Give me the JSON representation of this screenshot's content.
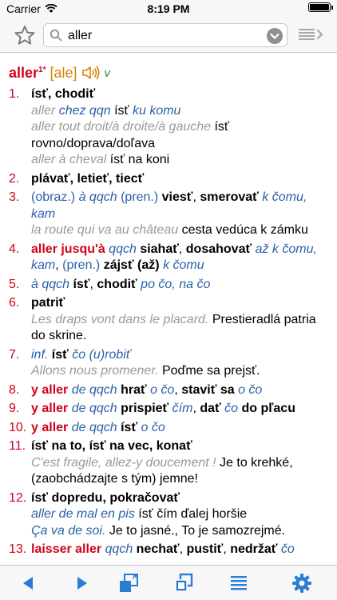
{
  "status_bar": {
    "carrier": "Carrier",
    "time": "8:19 PM",
    "battery_level_percent": 100
  },
  "search": {
    "value": "aller",
    "placeholder": ""
  },
  "colors": {
    "accent": "#2b7cd3",
    "headword": "#d0021b",
    "pronunciation": "#d9800a",
    "pos": "#2e8b2e",
    "example": "#999999",
    "label": "#2b5fa8"
  },
  "entry": {
    "headword": "aller",
    "homonym": "1*",
    "pronunciation": "[ale]",
    "pos": "v"
  },
  "senses": [
    {
      "num": "1.",
      "parts": [
        [
          "skb",
          "ísť, chodiť"
        ],
        [
          "br",
          ""
        ],
        [
          "fr",
          "aller "
        ],
        [
          "lbli",
          "chez qqn "
        ],
        [
          "sk",
          "ísť "
        ],
        [
          "lbli",
          "ku komu"
        ],
        [
          "br",
          ""
        ],
        [
          "fr",
          "aller tout droit/à droite/à gauche "
        ],
        [
          "sk",
          "ísť rovno/doprava/doľava"
        ],
        [
          "br",
          ""
        ],
        [
          "fr",
          "aller à cheval "
        ],
        [
          "sk",
          "ísť na koni"
        ]
      ]
    },
    {
      "num": "2.",
      "parts": [
        [
          "skb",
          "plávať, letieť, tiecť"
        ]
      ]
    },
    {
      "num": "3.",
      "parts": [
        [
          "lbl",
          "(obraz.) "
        ],
        [
          "lbli",
          "à qqch "
        ],
        [
          "lbl",
          "(pren.) "
        ],
        [
          "skb",
          "viesť"
        ],
        [
          "sk",
          ", "
        ],
        [
          "skb",
          "smerovať "
        ],
        [
          "lbli",
          "k čomu, kam"
        ],
        [
          "br",
          ""
        ],
        [
          "fr",
          "la route qui va au château "
        ],
        [
          "sk",
          "cesta vedúca k zámku"
        ]
      ]
    },
    {
      "num": "4.",
      "parts": [
        [
          "frb",
          "aller jusqu'à "
        ],
        [
          "lbli",
          "qqch "
        ],
        [
          "skb",
          "siahať"
        ],
        [
          "sk",
          ", "
        ],
        [
          "skb",
          "dosahovať "
        ],
        [
          "lbli",
          "až k čomu, kam"
        ],
        [
          "sk",
          ", "
        ],
        [
          "lbl",
          "(pren.) "
        ],
        [
          "skb",
          "zájsť (až) "
        ],
        [
          "lbli",
          "k čomu"
        ]
      ]
    },
    {
      "num": "5.",
      "parts": [
        [
          "lbli",
          "à qqch "
        ],
        [
          "skb",
          "ísť"
        ],
        [
          "sk",
          ", "
        ],
        [
          "skb",
          "chodiť "
        ],
        [
          "lbli",
          "po čo, na čo"
        ]
      ]
    },
    {
      "num": "6.",
      "parts": [
        [
          "skb",
          "patriť"
        ],
        [
          "br",
          ""
        ],
        [
          "fr",
          "Les draps vont dans le placard. "
        ],
        [
          "sk",
          "Prestieradlá patria do skrine."
        ]
      ]
    },
    {
      "num": "7.",
      "parts": [
        [
          "lbli",
          "inf. "
        ],
        [
          "skb",
          "ísť "
        ],
        [
          "lbli",
          "čo (u)robiť"
        ],
        [
          "br",
          ""
        ],
        [
          "fr",
          "Allons nous promener. "
        ],
        [
          "sk",
          "Poďme sa prejsť."
        ]
      ]
    },
    {
      "num": "8.",
      "parts": [
        [
          "frb",
          "y aller "
        ],
        [
          "lbli",
          "de qqch "
        ],
        [
          "skb",
          "hrať "
        ],
        [
          "lbli",
          "o čo"
        ],
        [
          "sk",
          ", "
        ],
        [
          "skb",
          "staviť sa "
        ],
        [
          "lbli",
          "o čo"
        ]
      ]
    },
    {
      "num": "9.",
      "parts": [
        [
          "frb",
          "y aller "
        ],
        [
          "lbli",
          "de qqch "
        ],
        [
          "skb",
          "prispieť "
        ],
        [
          "lbli",
          "čím"
        ],
        [
          "sk",
          ", "
        ],
        [
          "skb",
          "dať "
        ],
        [
          "lbli",
          "čo "
        ],
        [
          "skb",
          "do pľacu"
        ]
      ]
    },
    {
      "num": "10.",
      "parts": [
        [
          "frb",
          "y aller "
        ],
        [
          "lbli",
          "de qqch "
        ],
        [
          "skb",
          "ísť "
        ],
        [
          "lbli",
          "o čo"
        ]
      ]
    },
    {
      "num": "11.",
      "parts": [
        [
          "skb",
          "ísť na to, ísť na vec, konať"
        ],
        [
          "br",
          ""
        ],
        [
          "fr",
          "C'est fragile, allez-y doucement ! "
        ],
        [
          "sk",
          "Je to krehké, (zaobchádzajte s tým) jemne!"
        ]
      ]
    },
    {
      "num": "12.",
      "parts": [
        [
          "skb",
          "ísť dopredu, pokračovať"
        ],
        [
          "br",
          ""
        ],
        [
          "lbli",
          "aller de mal en pis "
        ],
        [
          "sk",
          "ísť čím ďalej horšie"
        ],
        [
          "br",
          ""
        ],
        [
          "lbli",
          "Ça va de soi. "
        ],
        [
          "sk",
          "Je to jasné., To je samozrejmé."
        ]
      ]
    },
    {
      "num": "13.",
      "parts": [
        [
          "frb",
          "laisser aller "
        ],
        [
          "lbli",
          "qqch "
        ],
        [
          "skb",
          "nechať"
        ],
        [
          "sk",
          ", "
        ],
        [
          "skb",
          "pustiť"
        ],
        [
          "sk",
          ", "
        ],
        [
          "skb",
          "nedržať "
        ],
        [
          "lbli",
          "čo"
        ]
      ]
    }
  ],
  "toolbar": {
    "buttons": [
      "back-arrow-icon",
      "forward-arrow-icon",
      "new-window-icon",
      "windows-icon",
      "list-icon",
      "settings-gear-icon"
    ]
  }
}
